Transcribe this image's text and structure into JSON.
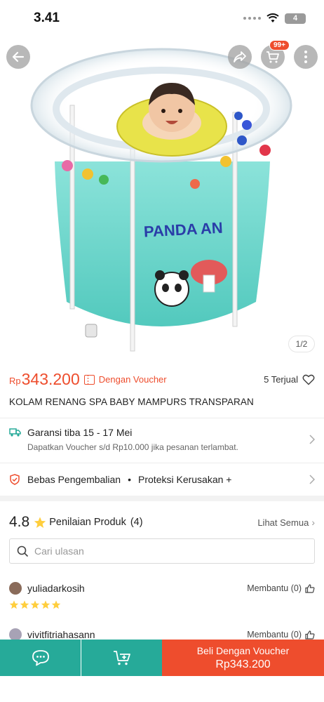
{
  "status_bar": {
    "time": "3.41",
    "battery": "4"
  },
  "header": {
    "cart_badge": "99+"
  },
  "gallery": {
    "page_indicator": "1/2"
  },
  "product": {
    "currency": "Rp",
    "price": "343.200",
    "voucher_label": "Dengan Voucher",
    "sold": "5 Terjual",
    "title": "KOLAM RENANG SPA BABY MAMPURS TRANSPARAN"
  },
  "shipping": {
    "title": "Garansi tiba 15 - 17 Mei",
    "subtitle": "Dapatkan Voucher s/d Rp10.000 jika pesanan terlambat."
  },
  "returns": {
    "label1": "Bebas Pengembalian",
    "bullet": "•",
    "label2": "Proteksi Kerusakan +"
  },
  "ratings": {
    "value": "4.8",
    "label": "Penilaian Produk",
    "count": "(4)",
    "see_all": "Lihat Semua",
    "search_placeholder": "Cari ulasan"
  },
  "reviews": [
    {
      "user": "yuliadarkosih",
      "helpful": "Membantu (0)",
      "stars": 5
    },
    {
      "user": "vivitfitriahasann",
      "helpful": "Membantu (0)"
    }
  ],
  "bottom_bar": {
    "buy_label": "Beli Dengan Voucher",
    "buy_price": "Rp343.200"
  },
  "colors": {
    "primary": "#ee4d2d",
    "teal": "#26aa99",
    "star": "#ffce3d"
  },
  "icons": [
    "back-arrow-icon",
    "share-icon",
    "cart-icon",
    "more-icon",
    "truck-icon",
    "shield-icon",
    "star-icon",
    "search-icon",
    "thumbs-up-icon",
    "chat-icon",
    "add-to-cart-icon",
    "heart-icon",
    "voucher-icon",
    "chevron-right-icon"
  ]
}
